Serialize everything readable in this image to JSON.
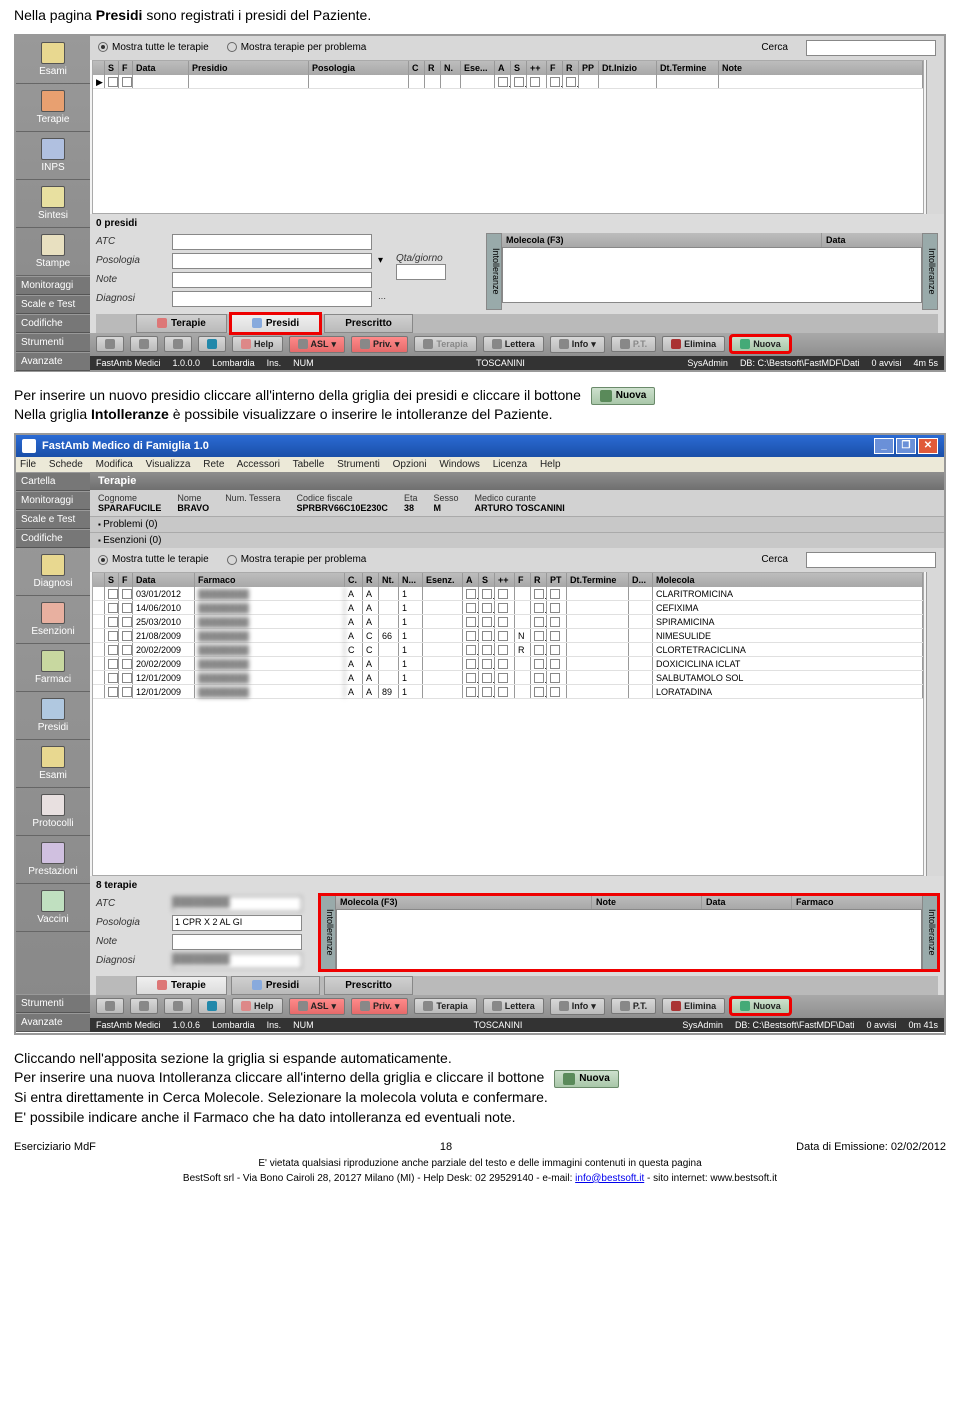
{
  "intro": {
    "text_before": "Nella pagina ",
    "bold": "Presidi",
    "text_after": " sono registrati i presidi del Paziente."
  },
  "s1": {
    "radio1": "Mostra tutte le terapie",
    "radio2": "Mostra terapie per problema",
    "search_lbl": "Cerca",
    "headers": [
      "S",
      "F",
      "Data",
      "Presidio",
      "Posologia",
      "C",
      "R",
      "N.",
      "Ese...",
      "A",
      "S",
      "++",
      "F",
      "R",
      "PP",
      "Dt.Inizio",
      "Dt.Termine",
      "Note"
    ],
    "count": "0 presidi",
    "atc": "ATC",
    "posologia": "Posologia",
    "qta": "Qta/giorno",
    "note": "Note",
    "diagnosi": "Diagnosi",
    "mol": "Molecola (F3)",
    "data": "Data",
    "intol": "Intolleranze",
    "tabs": {
      "t1": "Terapie",
      "t2": "Presidi",
      "t3": "Prescritto"
    },
    "bb": {
      "help": "Help",
      "asl": "ASL",
      "priv": "Priv.",
      "terapia": "Terapia",
      "lettera": "Lettera",
      "info": "Info",
      "pt": "P.T.",
      "elimina": "Elimina",
      "nuova": "Nuova"
    },
    "side": [
      "Esami",
      "Terapie",
      "INPS",
      "Sintesi",
      "Stampe"
    ],
    "sidemenu": [
      "Monitoraggi",
      "Scale e Test",
      "Codifiche",
      "Strumenti",
      "Avanzate"
    ],
    "status": [
      "FastAmb Medici",
      "1.0.0.0",
      "Lombardia",
      "Ins.",
      "NUM",
      "TOSCANINI",
      "SysAdmin",
      "DB: C:\\Bestsoft\\FastMDF\\Dati",
      "0 avvisi",
      "4m 5s"
    ]
  },
  "mid1": {
    "line1_a": "Per inserire un nuovo presidio cliccare all'interno della griglia dei presidi e cliccare il bottone",
    "nuova": "Nuova",
    "line2_a": "Nella griglia ",
    "line2_b": "Intolleranze",
    "line2_c": " è possibile visualizzare o inserire le intolleranze del Paziente."
  },
  "s2": {
    "title": "FastAmb Medico di Famiglia 1.0",
    "menu": [
      "File",
      "Schede",
      "Modifica",
      "Visualizza",
      "Rete",
      "Accessori",
      "Tabelle",
      "Strumenti",
      "Opzioni",
      "Windows",
      "Licenza",
      "Help"
    ],
    "section": "Terapie",
    "patient": {
      "cognome_l": "Cognome",
      "cognome": "SPARAFUCILE",
      "nome_l": "Nome",
      "nome": "BRAVO",
      "tessera_l": "Num. Tessera",
      "tessera": "",
      "cf_l": "Codice fiscale",
      "cf": "SPRBRV66C10E230C",
      "eta_l": "Eta",
      "eta": "38",
      "sesso_l": "Sesso",
      "sesso": "M",
      "medico_l": "Medico curante",
      "medico": "ARTURO TOSCANINI"
    },
    "exp1": "Problemi (0)",
    "exp2": "Esenzioni (0)",
    "radio1": "Mostra tutte le terapie",
    "radio2": "Mostra terapie per problema",
    "search_lbl": "Cerca",
    "headers": [
      "S",
      "F",
      "Data",
      "Farmaco",
      "C.",
      "R",
      "Nt.",
      "N...",
      "Esenz.",
      "A",
      "S",
      "++",
      "F",
      "R",
      "PT",
      "Dt.Termine",
      "D...",
      "Molecola"
    ],
    "rows": [
      {
        "d": "03/01/2012",
        "c": "A",
        "r": "A",
        "nt": "",
        "n": "1",
        "a": "",
        "s": "",
        "pp": "",
        "f": "",
        "rr": "",
        "pt": "",
        "dt": "",
        "dd": "",
        "mol": "CLARITROMICINA"
      },
      {
        "d": "14/06/2010",
        "c": "A",
        "r": "A",
        "nt": "",
        "n": "1",
        "a": "",
        "s": "",
        "pp": "",
        "f": "",
        "rr": "",
        "pt": "",
        "dt": "",
        "dd": "",
        "mol": "CEFIXIMA"
      },
      {
        "d": "25/03/2010",
        "c": "A",
        "r": "A",
        "nt": "",
        "n": "1",
        "a": "",
        "s": "",
        "pp": "",
        "f": "",
        "rr": "",
        "pt": "",
        "dt": "",
        "dd": "",
        "mol": "SPIRAMICINA"
      },
      {
        "d": "21/08/2009",
        "c": "A",
        "r": "C",
        "nt": "66",
        "n": "1",
        "a": "",
        "s": "",
        "pp": "",
        "f": "N",
        "rr": "",
        "pt": "",
        "dt": "",
        "dd": "",
        "mol": "NIMESULIDE"
      },
      {
        "d": "20/02/2009",
        "c": "C",
        "r": "C",
        "nt": "",
        "n": "1",
        "a": "",
        "s": "",
        "pp": "",
        "f": "R",
        "rr": "",
        "pt": "",
        "dt": "",
        "dd": "",
        "mol": "CLORTETRACICLINA"
      },
      {
        "d": "20/02/2009",
        "c": "A",
        "r": "A",
        "nt": "",
        "n": "1",
        "a": "",
        "s": "",
        "pp": "",
        "f": "",
        "rr": "",
        "pt": "",
        "dt": "",
        "dd": "",
        "mol": "DOXICICLINA ICLAT"
      },
      {
        "d": "12/01/2009",
        "c": "A",
        "r": "A",
        "nt": "",
        "n": "1",
        "a": "",
        "s": "",
        "pp": "",
        "f": "",
        "rr": "",
        "pt": "",
        "dt": "",
        "dd": "",
        "mol": "SALBUTAMOLO SOL"
      },
      {
        "d": "12/01/2009",
        "c": "A",
        "r": "A",
        "nt": "89",
        "n": "1",
        "a": "",
        "s": "",
        "pp": "",
        "f": "",
        "rr": "",
        "pt": "",
        "dt": "",
        "dd": "",
        "mol": "LORATADINA"
      }
    ],
    "count": "8 terapie",
    "atc": "ATC",
    "posologia": "Posologia",
    "pos_val": "1 CPR X 2 AL GI",
    "note": "Note",
    "diagnosi": "Diagnosi",
    "intol_h": [
      "Molecola (F3)",
      "Note",
      "Data",
      "Farmaco"
    ],
    "intol": "Intolleranze",
    "tabs": {
      "t1": "Terapie",
      "t2": "Presidi",
      "t3": "Prescritto"
    },
    "bb": {
      "help": "Help",
      "asl": "ASL",
      "priv": "Priv.",
      "terapia": "Terapia",
      "lettera": "Lettera",
      "info": "Info",
      "pt": "P.T.",
      "elimina": "Elimina",
      "nuova": "Nuova"
    },
    "side": [
      "Diagnosi",
      "Esenzioni",
      "Farmaci",
      "Presidi",
      "Esami",
      "Protocolli",
      "Prestazioni",
      "Vaccini"
    ],
    "sidemenu_top": [
      "Cartella",
      "Monitoraggi",
      "Scale e Test",
      "Codifiche"
    ],
    "sidemenu_bot": [
      "Strumenti",
      "Avanzate"
    ],
    "status": [
      "FastAmb Medici",
      "1.0.0.6",
      "Lombardia",
      "Ins.",
      "NUM",
      "TOSCANINI",
      "SysAdmin",
      "DB: C:\\Bestsoft\\FastMDF\\Dati",
      "0 avvisi",
      "0m 41s"
    ]
  },
  "mid2": {
    "p1": "Cliccando nell'apposita sezione la griglia si espande automaticamente.",
    "p2a": "Per inserire una nuova Intolleranza cliccare all'interno della griglia e cliccare il bottone",
    "nuova": "Nuova",
    "p3": "Si entra direttamente in Cerca Molecole. Selezionare la molecola voluta e confermare.",
    "p4": "E' possibile indicare anche il Farmaco che ha dato intolleranza ed eventuali note."
  },
  "footer": {
    "l": "Eserciziario MdF",
    "c": "18",
    "r": "Data di Emissione: 02/02/2012",
    "line2": "E' vietata qualsiasi riproduzione anche parziale del testo e delle immagini contenuti in questa pagina",
    "line3a": "BestSoft srl - Via Bono Cairoli 28, 20127 Milano (MI) - Help Desk: 02 29529140 - e-mail: ",
    "email": "info@bestsoft.it",
    "line3b": " - sito internet: ",
    "site": "www.bestsoft.it"
  }
}
